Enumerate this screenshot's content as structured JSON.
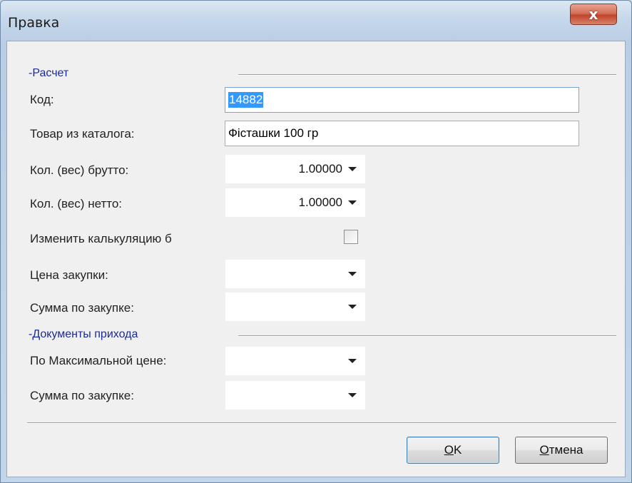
{
  "window": {
    "title": "Правка",
    "close_glyph": "x"
  },
  "groups": {
    "calc_title": "-Расчет",
    "docs_title": "-Документы прихода"
  },
  "fields": {
    "code": {
      "label": "Код:",
      "value": "14882"
    },
    "product": {
      "label": "Товар из каталога:",
      "value": "Фісташки  100 гр"
    },
    "qty_gross": {
      "label": "Кол. (вес) брутто:",
      "value": "1.00000"
    },
    "qty_net": {
      "label": "Кол. (вес) нетто:",
      "value": "1.00000"
    },
    "change_calc": {
      "label": "Изменить калькуляцию б",
      "checked": false
    },
    "purchase_price": {
      "label": "Цена закупки:",
      "value": ""
    },
    "purchase_sum": {
      "label": "Сумма по закупке:",
      "value": ""
    },
    "max_price": {
      "label": "По Максимальной цене:",
      "value": ""
    },
    "docs_purchase_sum": {
      "label": "Сумма по закупке:",
      "value": ""
    }
  },
  "buttons": {
    "ok_mnemonic": "O",
    "ok_rest": "K",
    "cancel_mnemonic": "О",
    "cancel_rest": "тмена"
  },
  "colors": {
    "group_title": "#1b2a9c",
    "selection": "#3399ff",
    "close_button": "#c2432b"
  }
}
